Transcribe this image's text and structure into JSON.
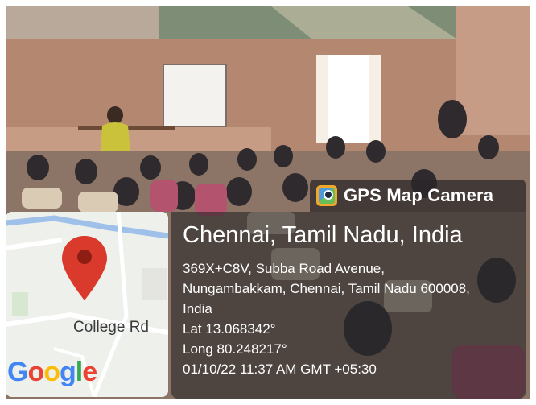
{
  "overlay": {
    "app_name": "GPS Map Camera",
    "icon": "gps-map-camera-logo-icon",
    "location_title": "Chennai, Tamil Nadu, India",
    "address_lines": [
      "369X+C8V, Subba Road Avenue,",
      "Nungambakkam, Chennai, Tamil Nadu 600008,",
      "India"
    ],
    "latitude": "Lat 13.068342°",
    "longitude": "Long 80.248217°",
    "timestamp": "01/10/22 11:37 AM GMT +05:30"
  },
  "map": {
    "road_label": "College Rd",
    "logo_letters": [
      "G",
      "o",
      "o",
      "g",
      "l",
      "e"
    ],
    "pin_icon": "map-pin-icon",
    "pin_color": "#d93a2b"
  },
  "colors": {
    "overlay_bg": "#282628",
    "google_blue": "#4285f4",
    "google_red": "#ea4335",
    "google_yellow": "#fbbc05",
    "google_green": "#34a853"
  }
}
